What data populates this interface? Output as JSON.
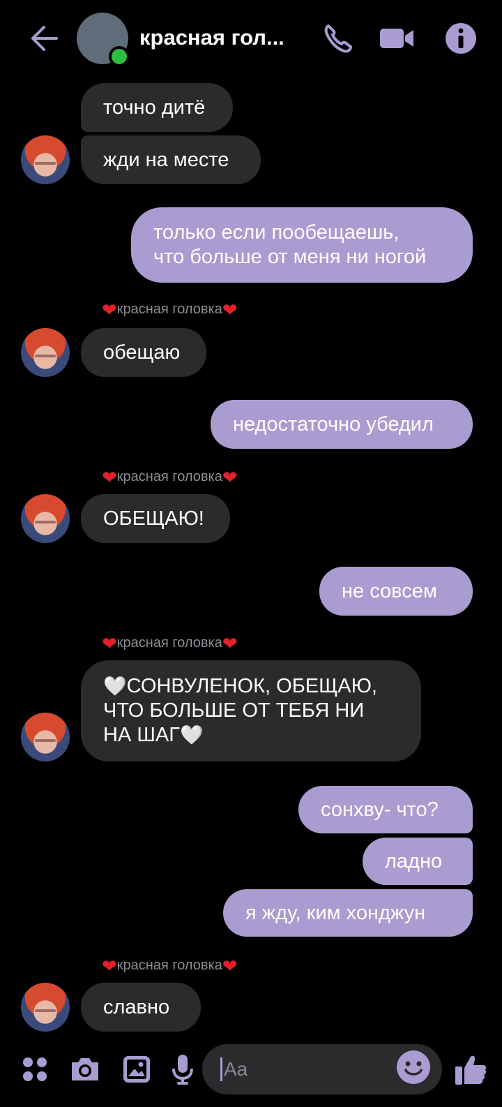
{
  "header": {
    "title": "красная гол...",
    "icons": [
      "back-arrow-icon",
      "phone-icon",
      "video-icon",
      "info-icon"
    ]
  },
  "colors": {
    "accent": "#a99cd1",
    "incoming_bubble": "#2b2b2e",
    "online": "#2dbd3f",
    "heart": "#e3202c"
  },
  "messages": [
    {
      "dir": "in",
      "text": "точно дитё"
    },
    {
      "dir": "in",
      "text": "жди на месте"
    },
    {
      "dir": "out",
      "line1": "только если пообещаешь,",
      "line2": "что больше от меня ни ногой"
    },
    {
      "dir": "sender",
      "name": "красная головка"
    },
    {
      "dir": "in",
      "text": "обещаю"
    },
    {
      "dir": "out",
      "text": "недостаточно убедил"
    },
    {
      "dir": "sender",
      "name": "красная головка"
    },
    {
      "dir": "in",
      "text": "ОБЕЩАЮ!"
    },
    {
      "dir": "out",
      "text": "не совсем"
    },
    {
      "dir": "sender",
      "name": "красная головка"
    },
    {
      "dir": "in",
      "line1": "СОНВУЛЕНОК, ОБЕЩАЮ,",
      "line2": "ЧТО БОЛЬШЕ ОТ ТЕБЯ НИ",
      "line3": "НА ШАГ"
    },
    {
      "dir": "out",
      "text": "сонхву- что?"
    },
    {
      "dir": "out",
      "text": "ладно"
    },
    {
      "dir": "out",
      "text": "я жду, ким хонджун"
    },
    {
      "dir": "sender",
      "name": "красная головка"
    },
    {
      "dir": "in",
      "text": "славно"
    }
  ],
  "composer": {
    "placeholder": "Aa",
    "icons": [
      "apps-icon",
      "camera-icon",
      "gallery-icon",
      "microphone-icon",
      "emoji-icon",
      "like-icon"
    ]
  }
}
